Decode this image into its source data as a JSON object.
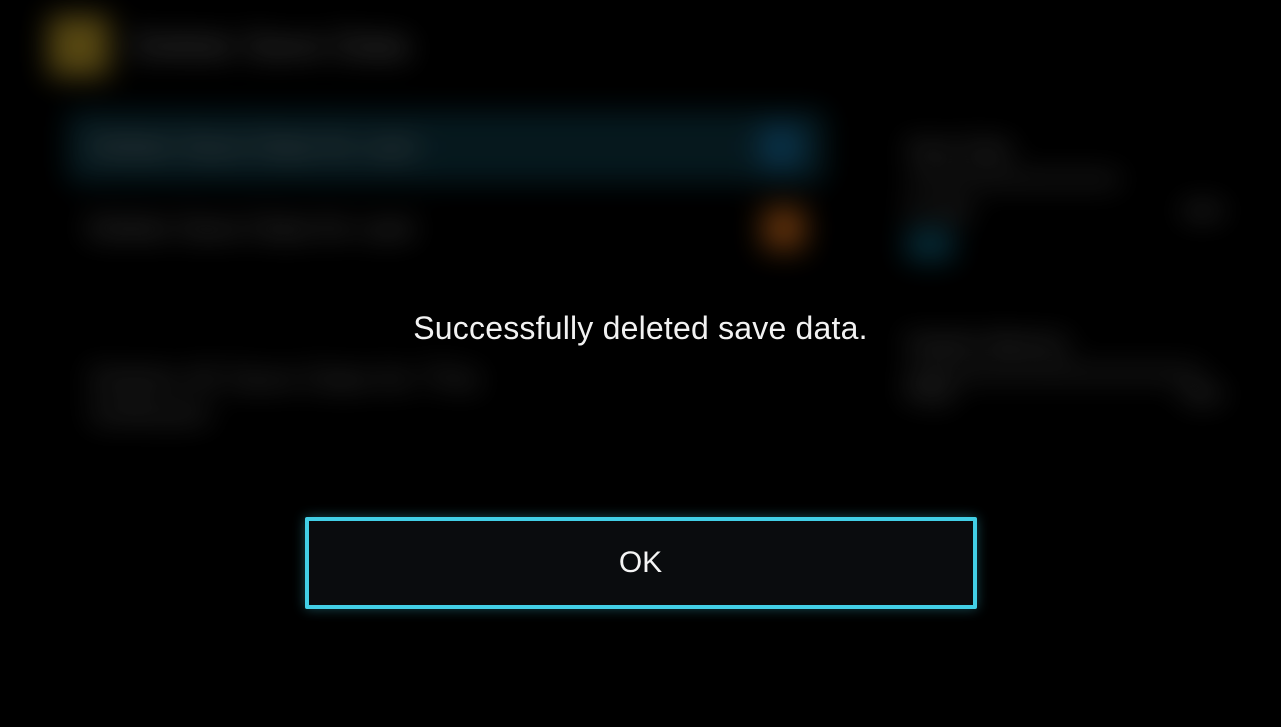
{
  "background": {
    "header_title": "Delete Save Data",
    "rows": [
      {
        "label": "Delete Save Data for user",
        "size": "size"
      },
      {
        "label": "Delete Save Data for user",
        "size": "size"
      }
    ],
    "confirm_line": "Delete All Save Data for This Software",
    "storage": {
      "section1_label": "Save Data",
      "used_label": "In Use",
      "used_value": "size",
      "section2_label": "System Memory",
      "free_label": "Free",
      "free_value": "size"
    }
  },
  "dialog": {
    "message": "Successfully deleted save data.",
    "ok_label": "OK"
  },
  "colors": {
    "accent": "#42cfe6"
  }
}
